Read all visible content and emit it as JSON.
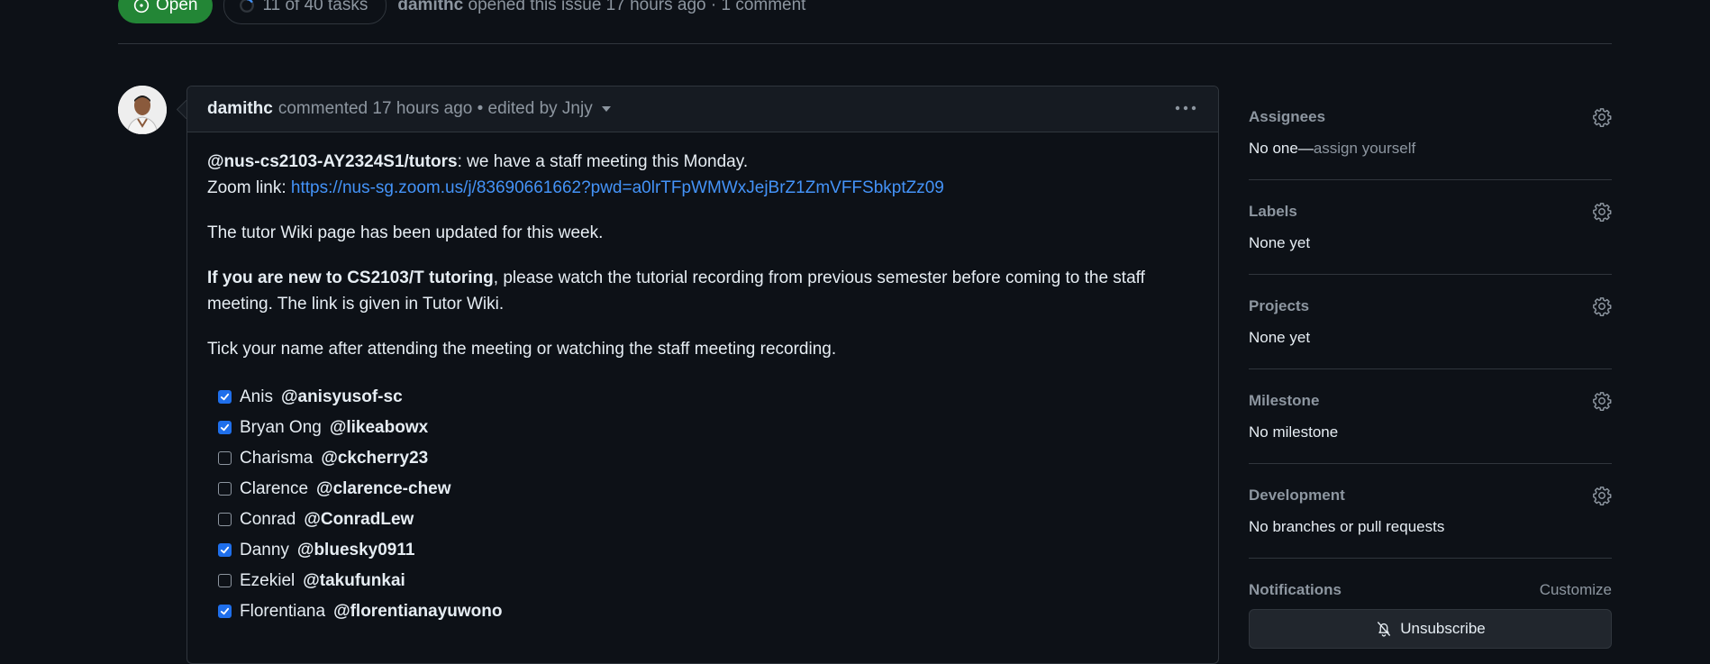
{
  "top": {
    "state": "Open",
    "tasks": "11 of 40 tasks",
    "opener": "damithc",
    "meta_text": " opened this issue 17 hours ago · 1 comment",
    "tasks_progress": 0.275
  },
  "comment": {
    "author": "damithc",
    "header_text": "commented 17 hours ago • edited by Jnjy",
    "mention_team": "@nus-cs2103-AY2324S1/tutors",
    "line1_rest": ": we have a staff meeting this Monday.",
    "zoom_label": "Zoom link: ",
    "zoom_url": "https://nus-sg.zoom.us/j/83690661662?pwd=a0lrTFpWMWxJejBrZ1ZmVFFSbkptZz09",
    "wiki_line": "The tutor Wiki page has been updated for this week.",
    "new_bold": "If you are new to CS2103/T tutoring",
    "new_rest": ", please watch the tutorial recording from previous semester before coming to the staff meeting. The link is given in Tutor Wiki.",
    "tick_line": "Tick your name after attending the meeting or watching the staff meeting recording.",
    "tasks": [
      {
        "name": "Anis",
        "handle": "@anisyusof-sc",
        "checked": true
      },
      {
        "name": "Bryan Ong",
        "handle": "@likeabowx",
        "checked": true
      },
      {
        "name": "Charisma",
        "handle": "@ckcherry23",
        "checked": false
      },
      {
        "name": "Clarence",
        "handle": "@clarence-chew",
        "checked": false
      },
      {
        "name": "Conrad",
        "handle": "@ConradLew",
        "checked": false
      },
      {
        "name": "Danny",
        "handle": "@bluesky0911",
        "checked": true
      },
      {
        "name": "Ezekiel",
        "handle": "@takufunkai",
        "checked": false
      },
      {
        "name": "Florentiana",
        "handle": "@florentianayuwono",
        "checked": true
      }
    ]
  },
  "sidebar": {
    "assignees": {
      "title": "Assignees",
      "value": "No one—",
      "link": "assign yourself"
    },
    "labels": {
      "title": "Labels",
      "value": "None yet"
    },
    "projects": {
      "title": "Projects",
      "value": "None yet"
    },
    "milestone": {
      "title": "Milestone",
      "value": "No milestone"
    },
    "development": {
      "title": "Development",
      "value": "No branches or pull requests"
    },
    "notifications": {
      "title": "Notifications",
      "customize": "Customize",
      "unsubscribe": "Unsubscribe"
    }
  },
  "colors": {
    "accent": "#238636",
    "link": "#4493f8",
    "checkbox": "#1f6feb",
    "bg": "#0d1117"
  }
}
